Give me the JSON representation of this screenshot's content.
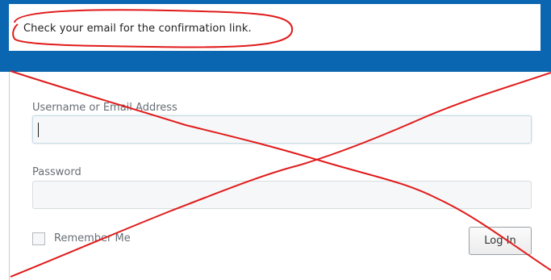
{
  "message": {
    "text": "Check your email for the confirmation link."
  },
  "login_form": {
    "username_label": "Username or Email Address",
    "username_value": "",
    "password_label": "Password",
    "password_value": "",
    "remember_label": "Remember Me",
    "remember_checked": false,
    "login_button_label": "Log In"
  },
  "colors": {
    "accent_blue": "#0a66b0",
    "annotation_red": "#e11b1b"
  }
}
